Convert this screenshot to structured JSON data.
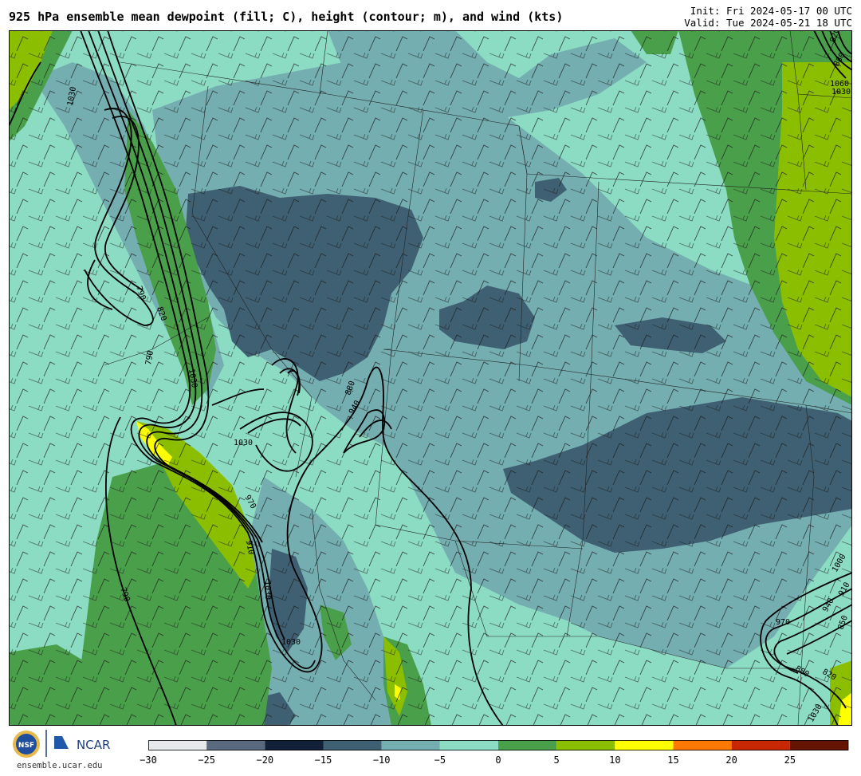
{
  "header": {
    "title": "925 hPa ensemble mean dewpoint (fill; C), height (contour; m), and wind (kts)",
    "init": "Init: Fri 2024-05-17 00 UTC",
    "valid": "Valid: Tue 2024-05-21 18 UTC"
  },
  "footer": {
    "site": "ensemble.ucar.edu",
    "logo_nsf": "NSF",
    "logo_ncar": "NCAR"
  },
  "colorbar": {
    "ticks": [
      "−30",
      "−25",
      "−20",
      "−15",
      "−10",
      "−5",
      "0",
      "5",
      "10",
      "15",
      "20",
      "25"
    ],
    "colors": [
      "#e6e9ec",
      "#5a6a7e",
      "#12203a",
      "#3f6073",
      "#74aeb1",
      "#8cdcc3",
      "#4aa04a",
      "#8cbe00",
      "#ffff00",
      "#ff7800",
      "#c82800",
      "#641400"
    ]
  },
  "map": {
    "contour_labels": [
      "790",
      "820",
      "850",
      "880",
      "910",
      "940",
      "970",
      "1000",
      "1030",
      "1060",
      "1090"
    ],
    "palette": {
      "very_dry": "#3f6073",
      "dry": "#74aeb1",
      "moist": "#8cdcc3",
      "green": "#4aa04a",
      "yellowgreen": "#8cbe00",
      "yellow": "#ffff00"
    }
  }
}
